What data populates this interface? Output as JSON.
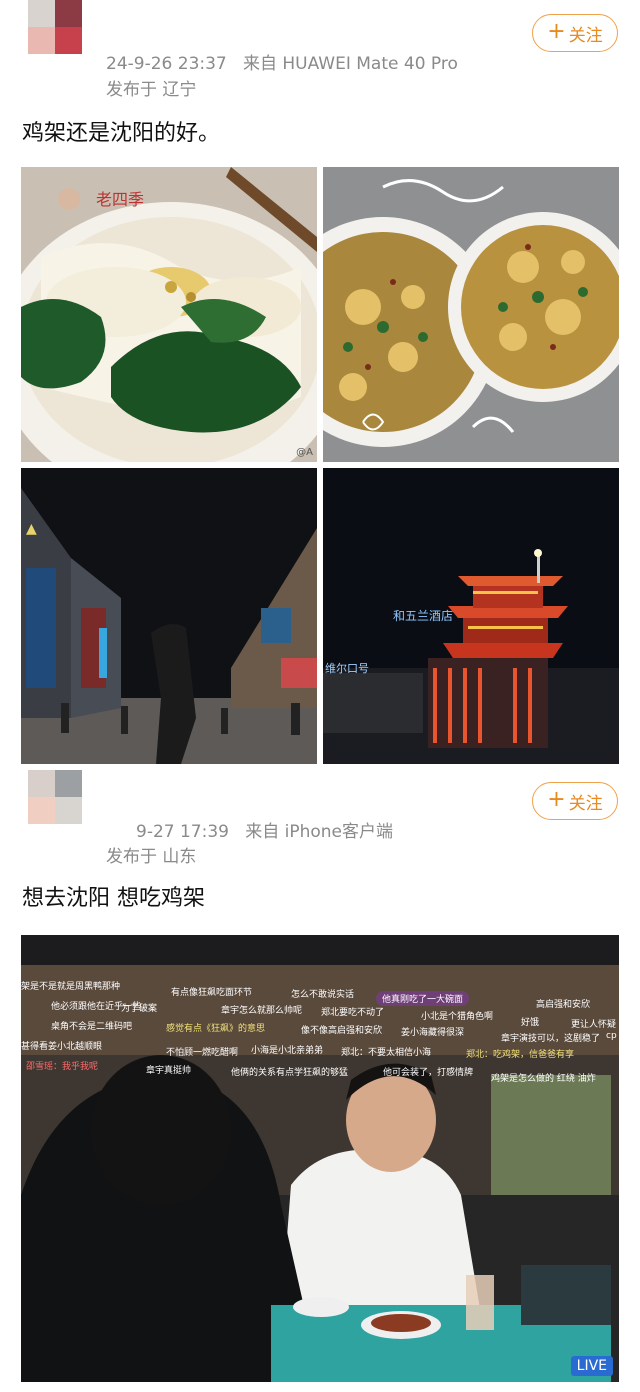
{
  "post1": {
    "meta_time": "24-9-26 23:37",
    "meta_source_prefix": "来自",
    "meta_device": "HUAWEI Mate 40 Pro",
    "meta_location": "发布于 辽宁",
    "follow_label": "关注",
    "text": "鸡架还是沈阳的好。",
    "watermark_text": "@A",
    "sign_mid": "和五兰酒店",
    "sign_left": "维尔口号"
  },
  "post2": {
    "meta_time": "9-27 17:39",
    "meta_source_prefix": "来自",
    "meta_device": "iPhone客户端",
    "meta_location": "发布于 山东",
    "follow_label": "关注",
    "text": "想去沈阳 想吃鸡架",
    "live_label": "LIVE",
    "danmaku": [
      "架是不是就是周黑鸭那种",
      "有点像狂飙吃面环节",
      "怎么不敢说实话",
      "他真刚吃了一大碗面",
      "高启强和安欣",
      "他必须跟他在近乎一些",
      "为了破案",
      "章宇怎么就那么帅呢",
      "郑北要吃不动了",
      "小北是个猎角色啊",
      "好饿",
      "更让人怀疑",
      "桌角不会是二维码吧",
      "感觉有点《狂飙》的意思",
      "像不像高启强和安欣",
      "姜小海藏得很深",
      "章宇演技可以，这剧稳了",
      "cp",
      "甚得看姜小北越顺眼",
      "不怕顾一燃吃醋啊",
      "小海是小北亲弟弟",
      "郑北：不要太相信小海",
      "郑北：吃鸡架，信爸爸有享",
      "邵雪瑶：我乎我呢",
      "章宇真挺帅",
      "他俩的关系有点学狂飙的够猛",
      "他可会装了，打感情牌",
      "鸡架是怎么做的 红绕 油炸"
    ]
  },
  "colors": {
    "accent": "#e88a1e",
    "meta_gray": "#8a8a8a"
  }
}
